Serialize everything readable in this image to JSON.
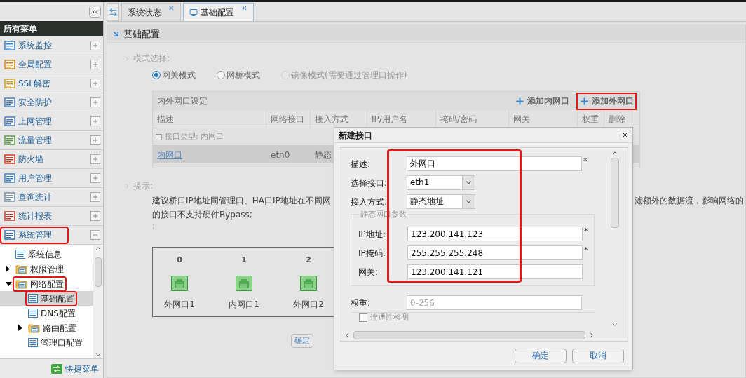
{
  "sidebar": {
    "header": "所有菜单",
    "items": [
      {
        "label": "系统监控",
        "expanded": false,
        "highlighted": false
      },
      {
        "label": "全局配置",
        "expanded": false,
        "highlighted": false
      },
      {
        "label": "SSL解密",
        "expanded": false,
        "highlighted": false
      },
      {
        "label": "安全防护",
        "expanded": false,
        "highlighted": false
      },
      {
        "label": "上网管理",
        "expanded": false,
        "highlighted": false
      },
      {
        "label": "流量管理",
        "expanded": false,
        "highlighted": false
      },
      {
        "label": "防火墙",
        "expanded": false,
        "highlighted": false
      },
      {
        "label": "用户管理",
        "expanded": false,
        "highlighted": false
      },
      {
        "label": "查询统计",
        "expanded": false,
        "highlighted": false
      },
      {
        "label": "统计报表",
        "expanded": false,
        "highlighted": false
      },
      {
        "label": "系统管理",
        "expanded": true,
        "highlighted": true
      }
    ],
    "tree": [
      {
        "label": "系统信息",
        "kind": "leaf",
        "selected": false,
        "highlighted": false
      },
      {
        "label": "权限管理",
        "kind": "folder",
        "expanded": false,
        "selected": false,
        "highlighted": false
      },
      {
        "label": "网络配置",
        "kind": "folder",
        "expanded": true,
        "selected": false,
        "highlighted": true,
        "children": [
          {
            "label": "基础配置",
            "kind": "leaf",
            "selected": true,
            "highlighted": true
          },
          {
            "label": "DNS配置",
            "kind": "leaf",
            "selected": false,
            "highlighted": false
          },
          {
            "label": "路由配置",
            "kind": "folder",
            "expanded": false,
            "selected": false,
            "highlighted": false
          },
          {
            "label": "管理口配置",
            "kind": "leaf",
            "selected": false,
            "highlighted": false
          }
        ]
      }
    ],
    "footer": "快捷菜单"
  },
  "tabs": [
    {
      "label": "系统状态",
      "selected": false
    },
    {
      "label": "基础配置",
      "selected": true
    }
  ],
  "panel_title": "基础配置",
  "mode_section": {
    "title": "模式选择:",
    "options": [
      {
        "label": "网关模式",
        "selected": true,
        "disabled": false
      },
      {
        "label": "网桥模式",
        "selected": false,
        "disabled": false
      },
      {
        "label": "镜像模式(需要通过管理口操作)",
        "selected": false,
        "disabled": true
      }
    ]
  },
  "interface_table": {
    "title": "内外网口设定",
    "actions": [
      {
        "label": "添加内网口",
        "highlighted": false
      },
      {
        "label": "添加外网口",
        "highlighted": true
      }
    ],
    "columns": [
      "描述",
      "网络接口",
      "接入方式",
      "IP/用户名",
      "掩码/密码",
      "网关",
      "权重",
      "删除"
    ],
    "groups": [
      {
        "label": "接口类型: 内网口",
        "expanded": true,
        "rows": [
          {
            "cells": [
              "内网口",
              "eth0",
              "静态"
            ]
          }
        ]
      }
    ]
  },
  "hint": {
    "title": "提示:",
    "line1_left": "建议桥口IP地址同管理口、HA口IP地址在不同网",
    "line1_right": "滤额外的数据流，影响网络的",
    "line2": "的接口不支持硬件Bypass;",
    "line3": ";"
  },
  "ports": [
    {
      "number": "0",
      "label": "外网口1"
    },
    {
      "number": "1",
      "label": "内网口1"
    },
    {
      "number": "2",
      "label": "外网口2"
    }
  ],
  "confirm_button": "确定",
  "dialog": {
    "title": "新建接口",
    "fields": [
      {
        "kind": "text",
        "label": "描述:",
        "value": "外网口",
        "required_mark": "*"
      },
      {
        "kind": "select",
        "label": "选择接口:",
        "value": "eth1"
      },
      {
        "kind": "select",
        "label": "接入方式:",
        "value": "静态地址"
      }
    ],
    "fieldset": {
      "legend": "静态网口参数",
      "fields": [
        {
          "kind": "text",
          "label": "IP地址:",
          "value": "123.200.141.123",
          "required_mark": "*"
        },
        {
          "kind": "text",
          "label": "IP掩码:",
          "value": "255.255.255.248",
          "required_mark": "*"
        },
        {
          "kind": "text",
          "label": "网关:",
          "value": "123.200.141.121"
        }
      ]
    },
    "weight": {
      "label": "权重:",
      "placeholder": "0-256"
    },
    "check": {
      "label": "连通性检测",
      "checked": false
    },
    "highlighted": true,
    "buttons": [
      "确定",
      "取消"
    ]
  }
}
